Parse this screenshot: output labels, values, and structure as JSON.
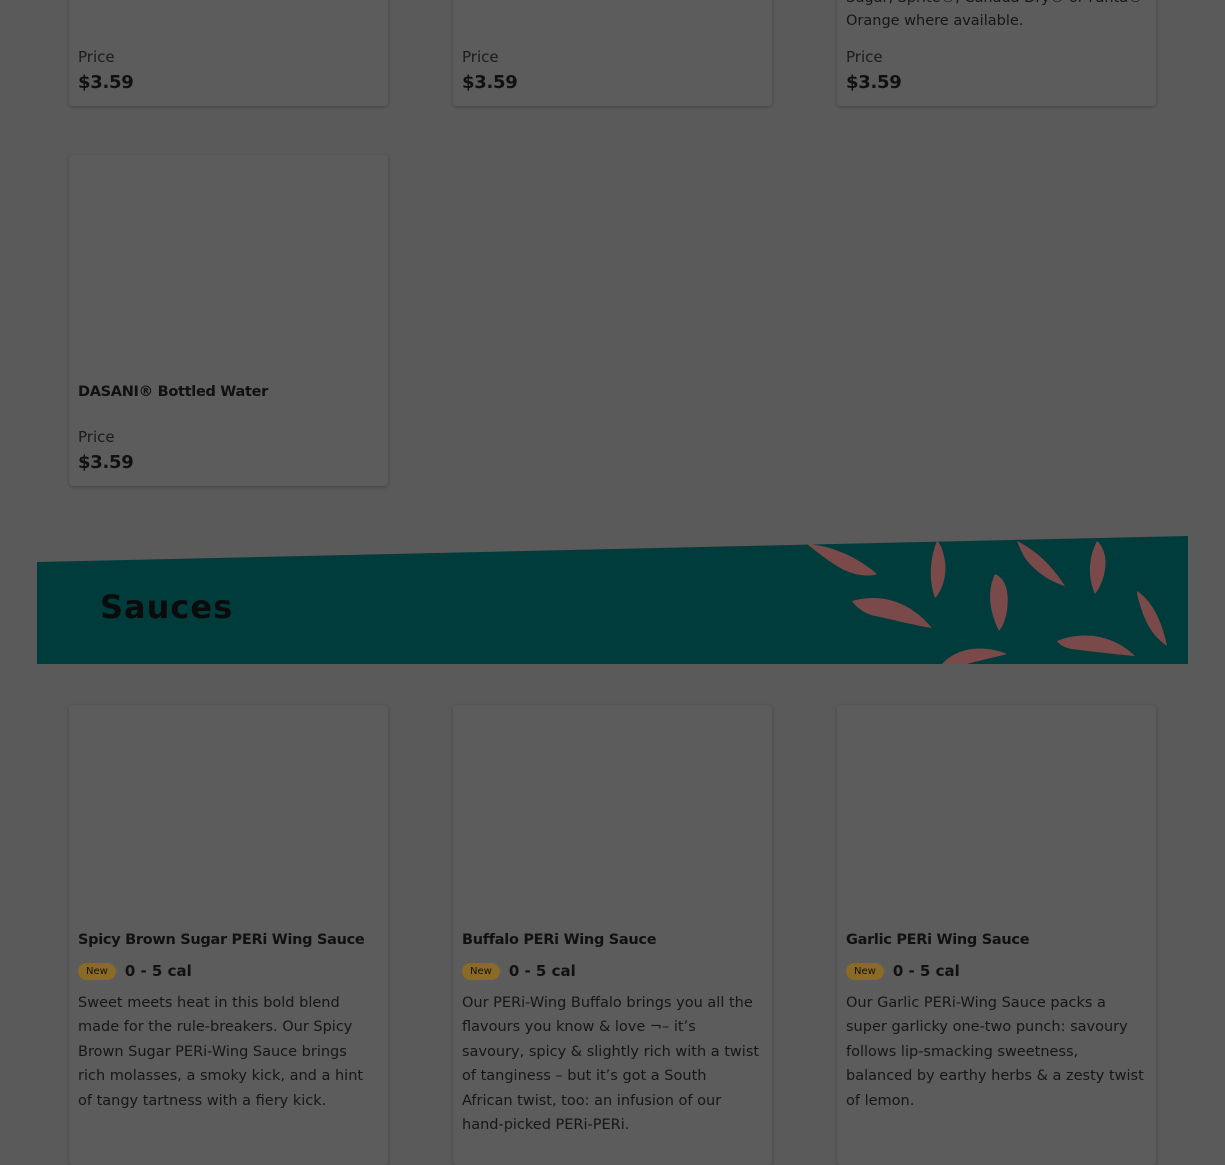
{
  "top_row": [
    {
      "price_label": "Price",
      "price": "$3.59"
    },
    {
      "price_label": "Price",
      "price": "$3.59"
    },
    {
      "desc_partial": "Sugar, Sprite®, Canada Dry® or Fanta®",
      "desc_line2": "Orange where available.",
      "price_label": "Price",
      "price": "$3.59"
    }
  ],
  "water": {
    "name": "DASANI® Bottled Water",
    "price_label": "Price",
    "price": "$3.59"
  },
  "section": {
    "title": "Sauces"
  },
  "sauces": [
    {
      "name": "Spicy Brown Sugar PERi Wing Sauce",
      "badge": "New",
      "calories": "0 - 5 cal",
      "desc": "Sweet meets heat in this bold blend made for the rule-breakers. Our Spicy Brown Sugar PERi-Wing Sauce brings rich molasses, a smoky kick, and a hint of tangy tartness with a fiery kick."
    },
    {
      "name": "Buffalo PERi Wing Sauce",
      "badge": "New",
      "calories": "0 - 5 cal",
      "desc": "Our PERi-Wing Buffalo brings you all the flavours you know & love ¬– it’s savoury, spicy & slightly rich with a twist of tanginess – but it’s got a South African twist, too: an infusion of our hand-picked PERi-PERi."
    },
    {
      "name": "Garlic PERi Wing Sauce",
      "badge": "New",
      "calories": "0 - 5 cal",
      "desc": "Our Garlic PERi-Wing Sauce packs a super garlicky one-two punch: savoury follows lip-smacking sweetness, balanced by earthy herbs & a zesty twist of lemon."
    }
  ],
  "colors": {
    "overlay_bg": "#5a5a5a",
    "banner": "#003c3c",
    "chili": "#7a4a4a",
    "badge": "#8a6a24"
  }
}
